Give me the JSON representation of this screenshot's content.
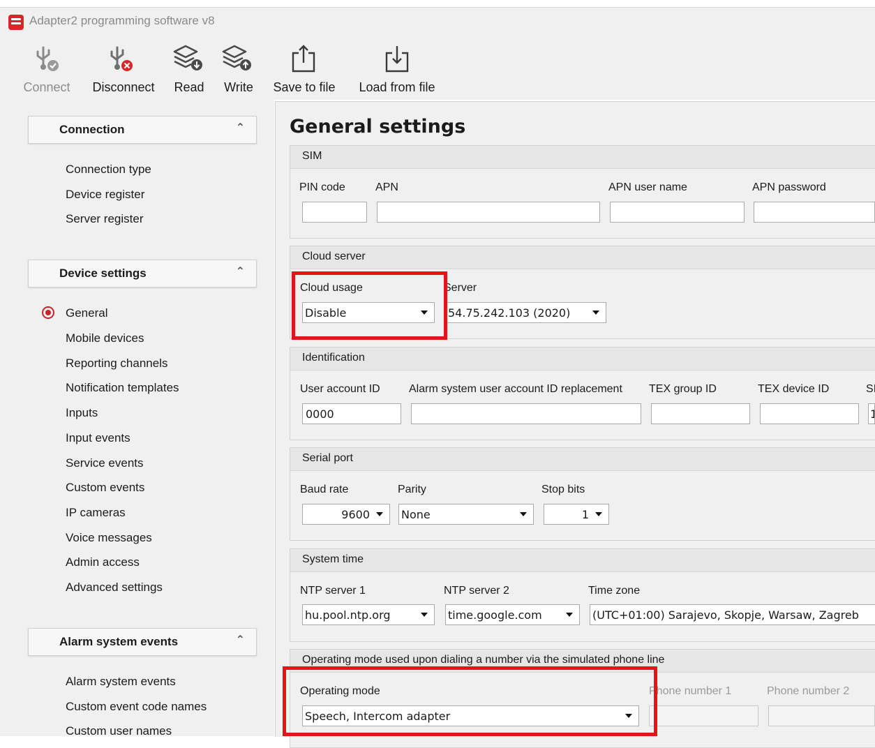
{
  "window": {
    "title": "Adapter2 programming software v8"
  },
  "toolbar": {
    "connect": "Connect",
    "disconnect": "Disconnect",
    "read": "Read",
    "write": "Write",
    "save_to_file": "Save to file",
    "load_from_file": "Load from file"
  },
  "sidebar": {
    "connection": {
      "title": "Connection",
      "items": [
        "Connection type",
        "Device register",
        "Server register"
      ]
    },
    "device_settings": {
      "title": "Device settings",
      "items": [
        "General",
        "Mobile devices",
        "Reporting channels",
        "Notification templates",
        "Inputs",
        "Input events",
        "Service events",
        "Custom events",
        "IP cameras",
        "Voice messages",
        "Admin access",
        "Advanced settings"
      ],
      "selected": "General"
    },
    "alarm_system_events": {
      "title": "Alarm system events",
      "items": [
        "Alarm system events",
        "Custom event code names",
        "Custom user names"
      ]
    }
  },
  "main": {
    "title": "General settings",
    "sim": {
      "header": "SIM",
      "pin_label": "PIN code",
      "pin_value": "",
      "apn_label": "APN",
      "apn_value": "",
      "apn_user_label": "APN user name",
      "apn_user_value": "",
      "apn_password_label": "APN password",
      "apn_password_value": ""
    },
    "cloud": {
      "header": "Cloud server",
      "usage_label": "Cloud usage",
      "usage_value": "Disable",
      "server_label": "Server",
      "server_value": "54.75.242.103 (2020)"
    },
    "identification": {
      "header": "Identification",
      "user_account_label": "User account ID",
      "user_account_value": "0000",
      "replacement_label": "Alarm system user account ID replacement",
      "replacement_value": "",
      "tex_group_label": "TEX group ID",
      "tex_group_value": "",
      "tex_device_label": "TEX device ID",
      "tex_device_value": "",
      "cut_label": "SI",
      "cut_value": "1"
    },
    "serial": {
      "header": "Serial port",
      "baud_label": "Baud rate",
      "baud_value": "9600",
      "parity_label": "Parity",
      "parity_value": "None",
      "stop_label": "Stop bits",
      "stop_value": "1"
    },
    "time": {
      "header": "System time",
      "ntp1_label": "NTP server 1",
      "ntp1_value": "hu.pool.ntp.org",
      "ntp2_label": "NTP server 2",
      "ntp2_value": "time.google.com",
      "tz_label": "Time zone",
      "tz_value": "(UTC+01:00) Sarajevo, Skopje, Warsaw, Zagreb"
    },
    "operating": {
      "header": "Operating mode used upon dialing a number via the simulated phone line",
      "mode_label": "Operating mode",
      "mode_value": "Speech, Intercom adapter",
      "phone1_label": "Phone number 1",
      "phone1_value": "",
      "phone2_label": "Phone number 2",
      "phone2_value": ""
    }
  },
  "colors": {
    "accent": "#c9242a",
    "highlight": "#e4141b",
    "panel": "#f0f0f0"
  }
}
